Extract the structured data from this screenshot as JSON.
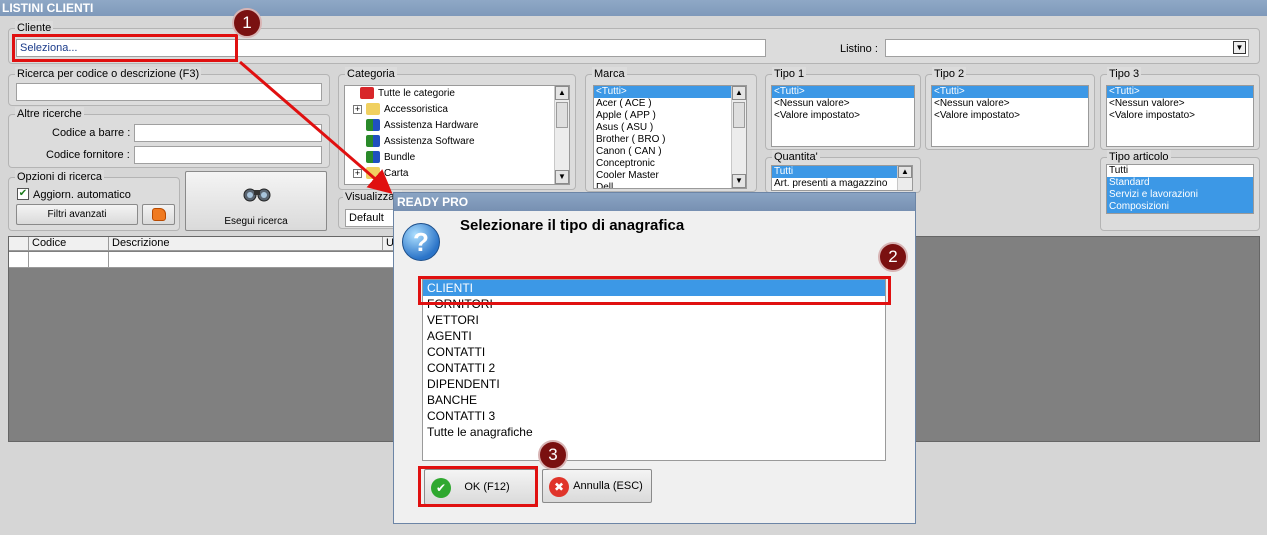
{
  "window": {
    "title": "LISTINI CLIENTI"
  },
  "cliente": {
    "legend": "Cliente",
    "placeholder": "Seleziona...",
    "listino_label": "Listino :"
  },
  "ricerca": {
    "legend": "Ricerca per codice o descrizione (F3)"
  },
  "altre": {
    "legend": "Altre ricerche",
    "barcode_label": "Codice a barre :",
    "fornitore_label": "Codice fornitore :"
  },
  "opzioni": {
    "legend": "Opzioni di ricerca",
    "auto_update": "Aggiorn. automatico",
    "auto_update_checked": true,
    "filtri": "Filtri avanzati",
    "esegui": "Esegui ricerca"
  },
  "categoria": {
    "legend": "Categoria",
    "items": [
      {
        "label": "Tutte le categorie",
        "icon": "strawberry-icon",
        "expander": ""
      },
      {
        "label": "Accessoristica",
        "icon": "folder-icon",
        "expander": "+"
      },
      {
        "label": "Assistenza Hardware",
        "icon": "shapes-icon",
        "expander": ""
      },
      {
        "label": "Assistenza Software",
        "icon": "shapes-icon",
        "expander": ""
      },
      {
        "label": "Bundle",
        "icon": "shapes-icon",
        "expander": ""
      },
      {
        "label": "Carta",
        "icon": "folder-icon",
        "expander": "+"
      }
    ]
  },
  "visualizza": {
    "legend": "Visualizzaz",
    "value": "Default"
  },
  "marca": {
    "legend": "Marca",
    "items": [
      "<Tutti>",
      "Acer ( ACE )",
      "Apple ( APP )",
      "Asus ( ASU )",
      "Brother ( BRO )",
      "Canon ( CAN )",
      "Conceptronic",
      "Cooler Master",
      "Dell"
    ]
  },
  "tipo1": {
    "legend": "Tipo 1",
    "items": [
      "<Tutti>",
      "<Nessun valore>",
      "<Valore impostato>"
    ]
  },
  "tipo2": {
    "legend": "Tipo 2",
    "items": [
      "<Tutti>",
      "<Nessun valore>",
      "<Valore impostato>"
    ]
  },
  "tipo3": {
    "legend": "Tipo 3",
    "items": [
      "<Tutti>",
      "<Nessun valore>",
      "<Valore impostato>"
    ]
  },
  "quantita": {
    "legend": "Quantita'",
    "items": [
      "Tutti",
      "Art. presenti a magazzino"
    ]
  },
  "tipo_articolo": {
    "legend": "Tipo articolo",
    "items": [
      "Tutti",
      "Standard",
      "Servizi e lavorazioni",
      "Composizioni"
    ]
  },
  "grid": {
    "columns": [
      "Codice",
      "Descrizione",
      "U"
    ]
  },
  "dialog": {
    "title": "READY PRO",
    "message": "Selezionare il tipo di anagrafica",
    "items": [
      "CLIENTI",
      "FORNITORI",
      "VETTORI",
      "AGENTI",
      "CONTATTI",
      "CONTATTI 2",
      "DIPENDENTI",
      "BANCHE",
      "CONTATTI 3",
      "Tutte le anagrafiche"
    ],
    "ok": "OK (F12)",
    "cancel": "Annulla (ESC)"
  },
  "annotations": {
    "b1": "1",
    "b2": "2",
    "b3": "3",
    "color": "#e01010"
  }
}
